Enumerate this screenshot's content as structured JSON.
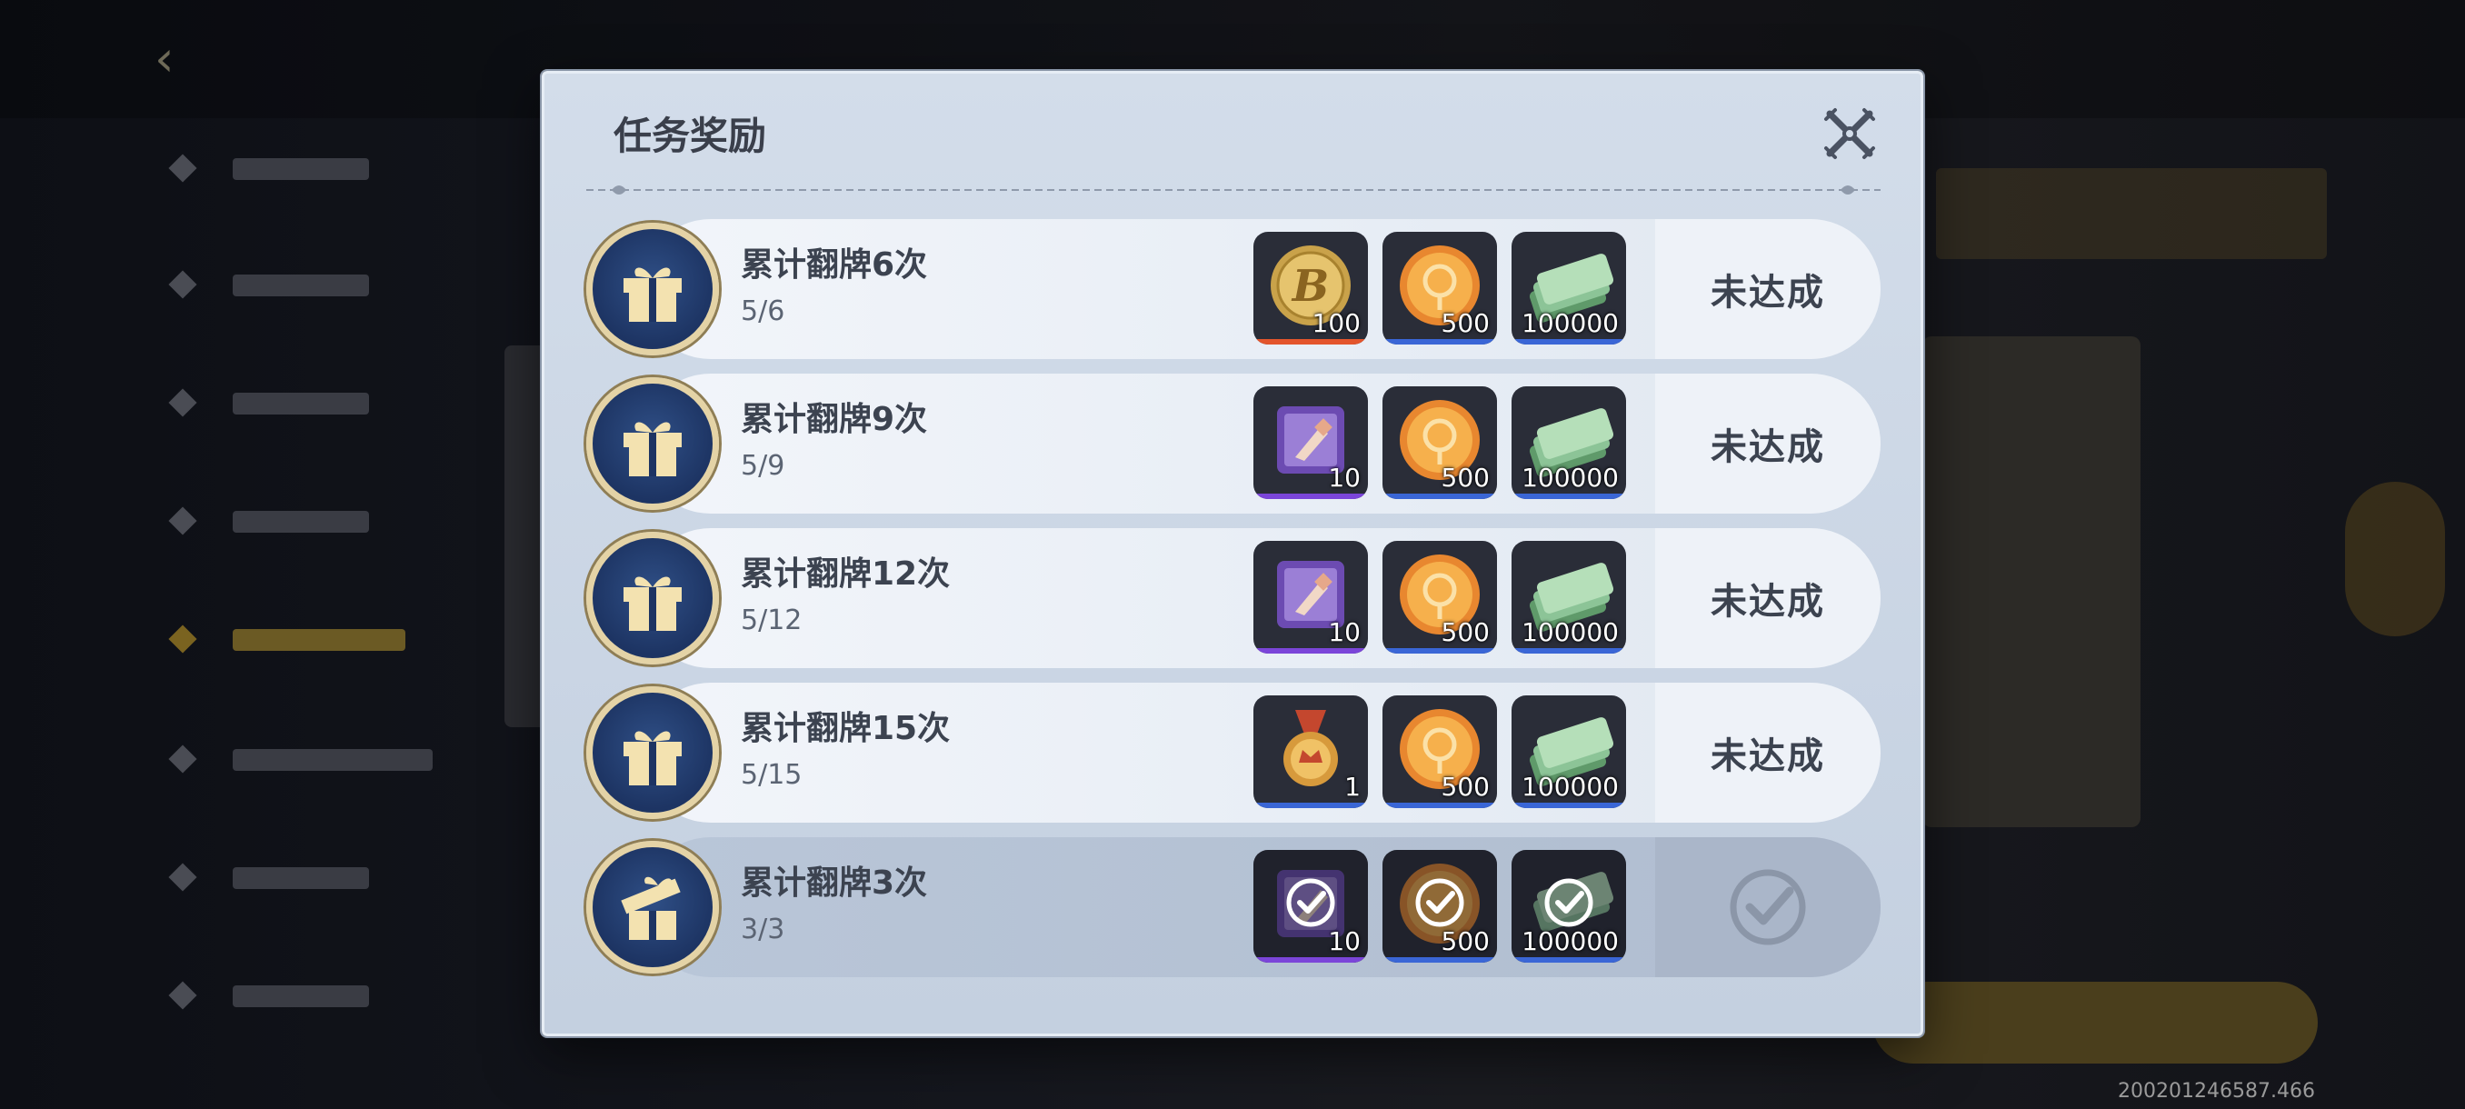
{
  "dialog": {
    "title": "任务奖励",
    "close_icon": "close-cross-icon"
  },
  "tasks": [
    {
      "name": "累计翻牌6次",
      "progress": "5/6",
      "status": "未达成",
      "completed": false,
      "rewards": [
        {
          "icon": "gold-b-coin-icon",
          "qty": "100",
          "rarity_color": "#e3552c"
        },
        {
          "icon": "orange-coin-icon",
          "qty": "500",
          "rarity_color": "#3a66d6"
        },
        {
          "icon": "cash-stack-icon",
          "qty": "100000",
          "rarity_color": "#3a66d6"
        }
      ]
    },
    {
      "name": "累计翻牌9次",
      "progress": "5/9",
      "status": "未达成",
      "completed": false,
      "rewards": [
        {
          "icon": "purple-chest-icon",
          "qty": "10",
          "rarity_color": "#7b45d9"
        },
        {
          "icon": "orange-coin-icon",
          "qty": "500",
          "rarity_color": "#3a66d6"
        },
        {
          "icon": "cash-stack-icon",
          "qty": "100000",
          "rarity_color": "#3a66d6"
        }
      ]
    },
    {
      "name": "累计翻牌12次",
      "progress": "5/12",
      "status": "未达成",
      "completed": false,
      "rewards": [
        {
          "icon": "purple-chest-icon",
          "qty": "10",
          "rarity_color": "#7b45d9"
        },
        {
          "icon": "orange-coin-icon",
          "qty": "500",
          "rarity_color": "#3a66d6"
        },
        {
          "icon": "cash-stack-icon",
          "qty": "100000",
          "rarity_color": "#3a66d6"
        }
      ]
    },
    {
      "name": "累计翻牌15次",
      "progress": "5/15",
      "status": "未达成",
      "completed": false,
      "rewards": [
        {
          "icon": "medal-icon",
          "qty": "1",
          "rarity_color": "#3a66d6"
        },
        {
          "icon": "orange-coin-icon",
          "qty": "500",
          "rarity_color": "#3a66d6"
        },
        {
          "icon": "cash-stack-icon",
          "qty": "100000",
          "rarity_color": "#3a66d6"
        }
      ]
    },
    {
      "name": "累计翻牌3次",
      "progress": "3/3",
      "status": "",
      "completed": true,
      "rewards": [
        {
          "icon": "purple-chest-icon",
          "qty": "10",
          "rarity_color": "#7b45d9"
        },
        {
          "icon": "orange-coin-icon",
          "qty": "500",
          "rarity_color": "#3a66d6"
        },
        {
          "icon": "cash-stack-icon",
          "qty": "100000",
          "rarity_color": "#3a66d6"
        }
      ]
    }
  ],
  "footer": {
    "build_id": "200201246587.466"
  }
}
